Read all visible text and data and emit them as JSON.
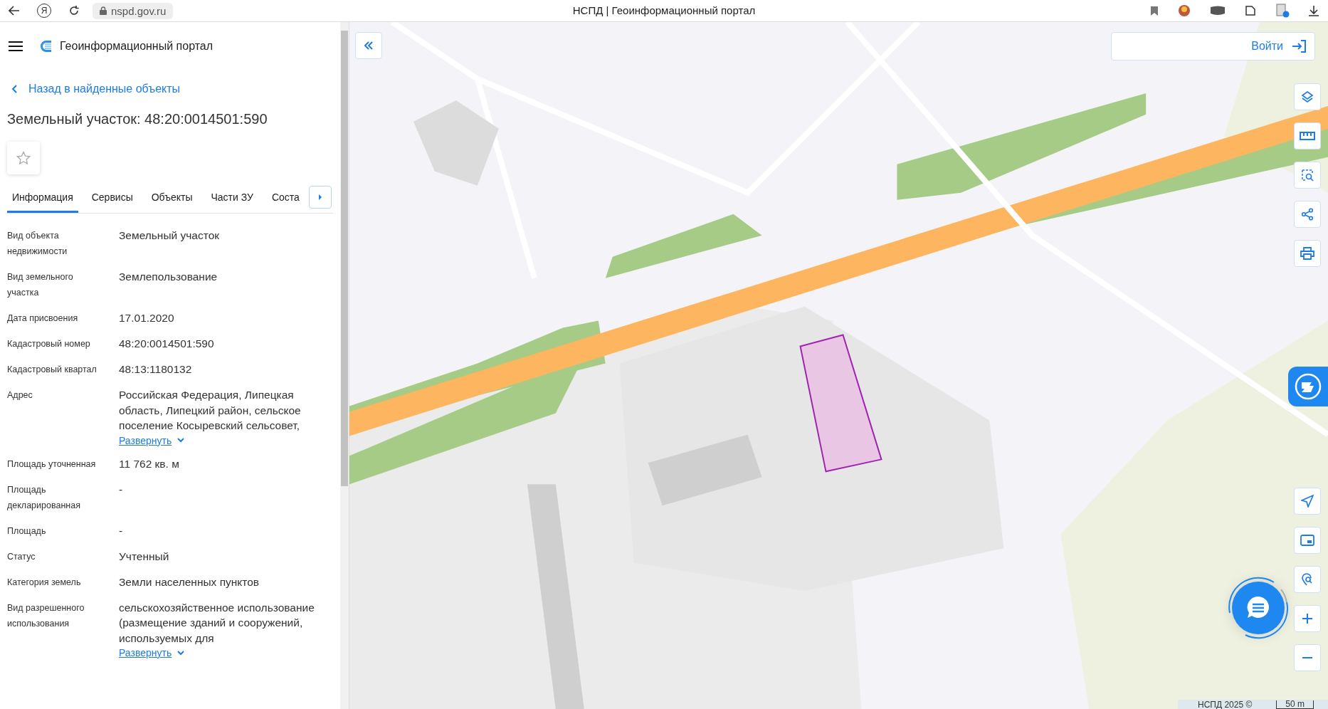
{
  "browser": {
    "logo_letter": "Я",
    "address": "nspd.gov.ru",
    "tab_title": "НСПД | Геоинформационный портал"
  },
  "header": {
    "title": "Геоинформационный портал"
  },
  "back_link": "Назад в найденные объекты",
  "object_title": "Земельный участок: 48:20:0014501:590",
  "favorite": {
    "on": false
  },
  "tabs": [
    {
      "label": "Информация",
      "selected": true
    },
    {
      "label": "Сервисы",
      "selected": false
    },
    {
      "label": "Объекты",
      "selected": false
    },
    {
      "label": "Части ЗУ",
      "selected": false
    },
    {
      "label": "Соста",
      "selected": false
    }
  ],
  "properties": [
    {
      "label": "Вид объекта недвижимости",
      "value": "Земельный участок"
    },
    {
      "label": "Вид земельного участка",
      "value": "Землепользование"
    },
    {
      "label": "Дата присвоения",
      "value": "17.01.2020"
    },
    {
      "label": "Кадастровый номер",
      "value": "48:20:0014501:590"
    },
    {
      "label": "Кадастровый квартал",
      "value": "48:13:1180132"
    },
    {
      "label": "Адрес",
      "value": "Российская Федерация, Липецкая область, Липецкий район, сельское поселение Косыревский сельсовет,",
      "expand": "Развернуть"
    },
    {
      "label": "Площадь уточненная",
      "value": "11 762 кв. м"
    },
    {
      "label": "Площадь декларированная",
      "value": "-"
    },
    {
      "label": "Площадь",
      "value": "-"
    },
    {
      "label": "Статус",
      "value": "Учтенный"
    },
    {
      "label": "Категория земель",
      "value": "Земли населенных пунктов"
    },
    {
      "label": "Вид разрешенного использования",
      "value": "сельскохозяйственное использование (размещение зданий и сооружений, используемых для",
      "expand": "Развернуть"
    }
  ],
  "map": {
    "login": "Войти",
    "attribution": "НСПД 2025 ©",
    "scale": "50 m"
  }
}
